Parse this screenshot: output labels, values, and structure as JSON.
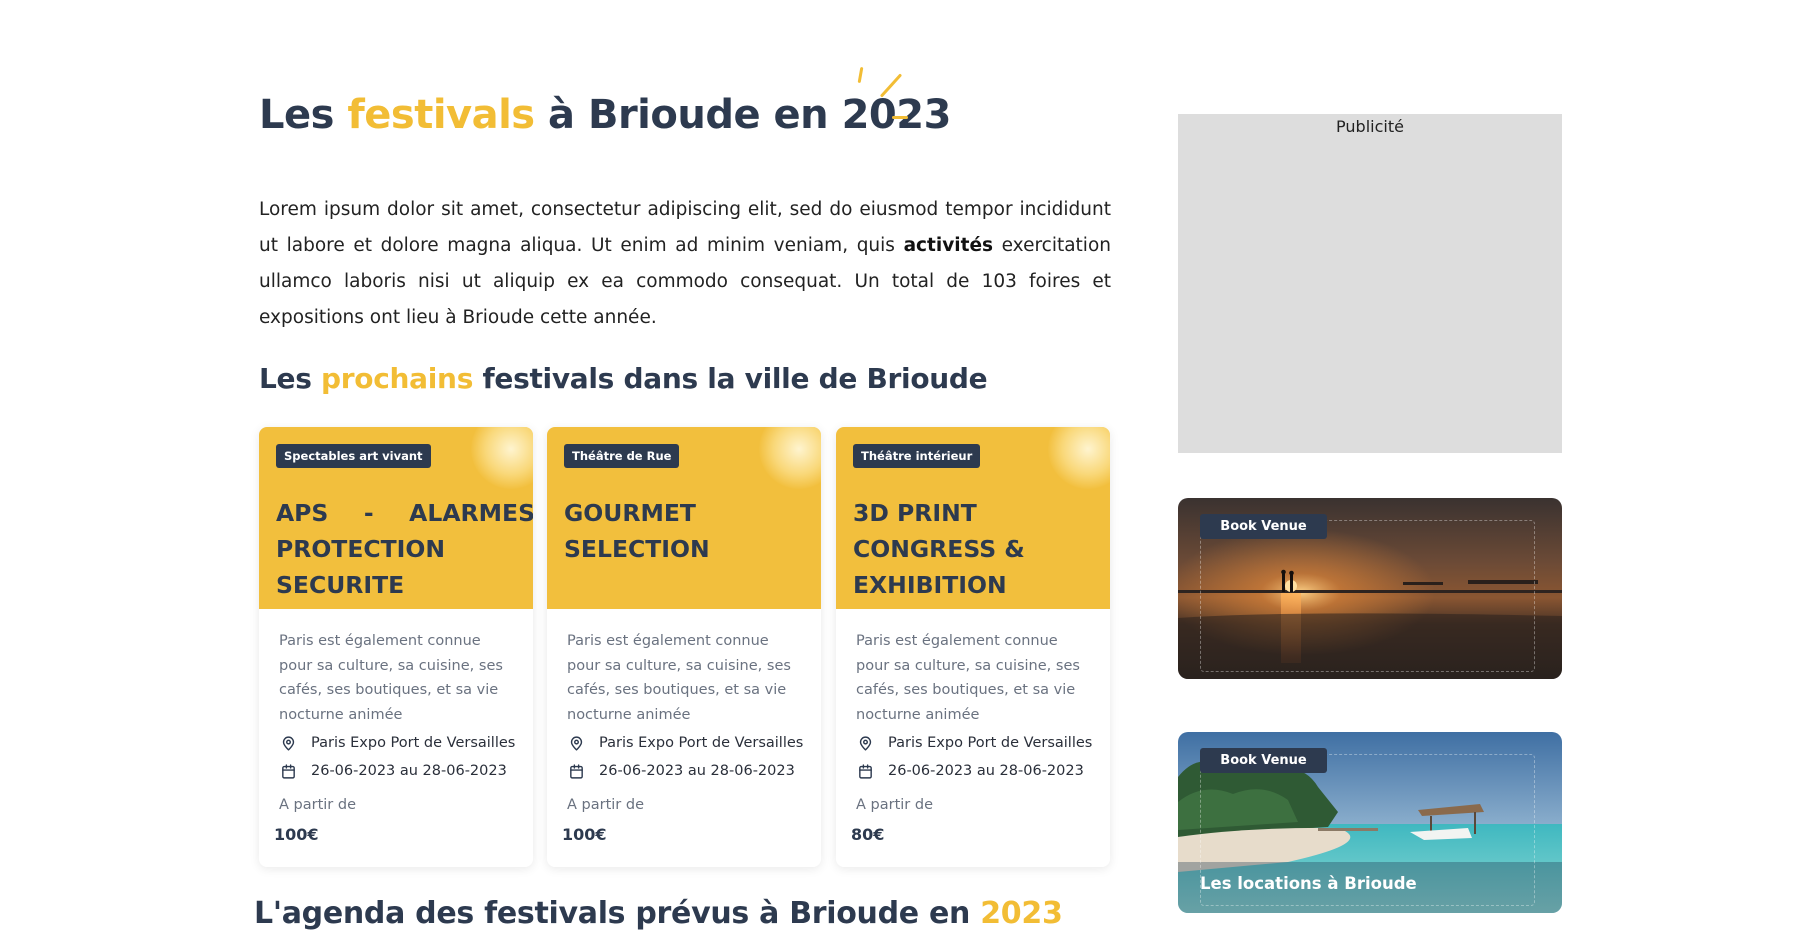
{
  "heading": {
    "prefix": "Les ",
    "accent": "festivals",
    "suffix": " à Brioude en 2023"
  },
  "intro": {
    "part1": "Lorem ipsum dolor sit amet, consectetur adipiscing elit, sed do eiusmod tempor incididunt ut labore et dolore magna aliqua. Ut enim ad minim veniam, quis ",
    "bold": "activités",
    "part2": " exercitation ullamco laboris nisi ut aliquip ex ea commodo consequat. Un total de 103 foires et expositions ont lieu à Brioude cette année."
  },
  "upcoming": {
    "prefix": "Les ",
    "accent": "prochains",
    "suffix": " festivals dans la ville de Brioude"
  },
  "cards": [
    {
      "badge": "Spectables art vivant",
      "title": "APS - ALARMES PROTECTION SECURITE",
      "description": "Paris est également connue pour sa culture, sa cuisine, ses cafés, ses boutiques, et sa vie nocturne animée",
      "location": "Paris Expo Port de Versailles",
      "dates": "26-06-2023 au 28-06-2023",
      "from_label": "A partir de",
      "price": "100€"
    },
    {
      "badge": "Théâtre de Rue",
      "title": "GOURMET SELECTION",
      "description": "Paris est également connue pour sa culture, sa cuisine, ses cafés, ses boutiques, et sa vie nocturne animée",
      "location": "Paris Expo Port de Versailles",
      "dates": "26-06-2023 au 28-06-2023",
      "from_label": "A partir de",
      "price": "100€"
    },
    {
      "badge": "Théâtre intérieur",
      "title": "3D PRINT CONGRESS & EXHIBITION",
      "description": "Paris est également connue pour sa culture, sa cuisine, ses cafés, ses boutiques, et sa vie nocturne animée",
      "location": "Paris Expo Port de Versailles",
      "dates": "26-06-2023 au 28-06-2023",
      "from_label": "A partir de",
      "price": "80€"
    }
  ],
  "agenda": {
    "prefix": "L'agenda des festivals prévus à Brioude en ",
    "accent": "2023"
  },
  "sidebar": {
    "ad_label": "Publicité",
    "venues": [
      {
        "badge": "Book Venue",
        "label": ""
      },
      {
        "badge": "Book Venue",
        "label": "Les locations à Brioude"
      }
    ]
  },
  "colors": {
    "accent": "#f2bd35",
    "navy": "#2d3a4f",
    "card_top": "#f2bf3d"
  }
}
